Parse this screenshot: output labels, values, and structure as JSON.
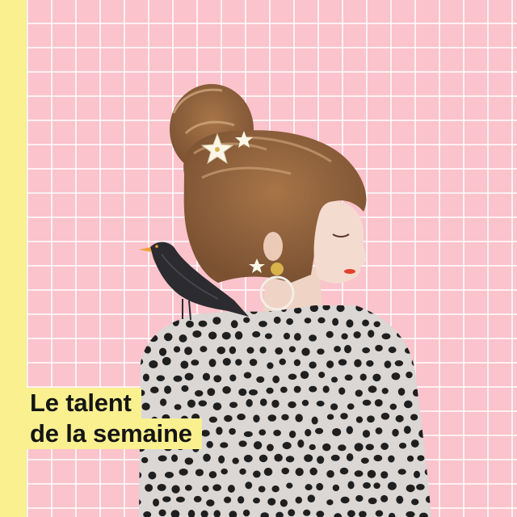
{
  "colors": {
    "accent_yellow": "#FAF08F",
    "background_pink": "#FBC3CB",
    "grid_line": "#FFFFFF",
    "hair": "#B98456",
    "skin": "#F4DDD0",
    "sweater": "#D9D6D4",
    "dot": "#1F1F1F",
    "bird": "#2A2A2E",
    "beak": "#F0A23A",
    "lips": "#E4412F",
    "caption_text": "#151515"
  },
  "caption": {
    "line1": "Le talent",
    "line2": "de la semaine"
  },
  "icons": [
    "star-icon",
    "star-icon",
    "star-icon"
  ]
}
